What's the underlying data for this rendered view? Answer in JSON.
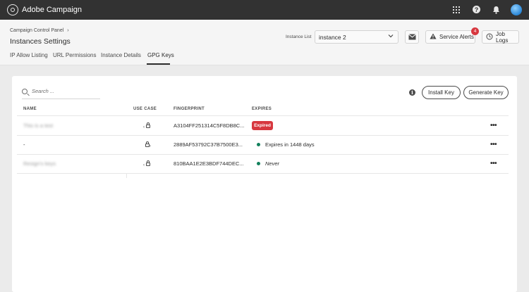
{
  "app": {
    "title": "Adobe Campaign"
  },
  "topbar": {
    "icons": [
      "apps-grid-icon",
      "help-icon",
      "notifications-bell-icon",
      "user-avatar"
    ]
  },
  "header": {
    "breadcrumb": "Campaign Control Panel",
    "breadcrumb_chevron": "›",
    "title": "Instances Settings",
    "tabs": [
      {
        "label": "IP Allow Listing",
        "active": false
      },
      {
        "label": "URL Permissions",
        "active": false
      },
      {
        "label": "Instance Details",
        "active": false
      },
      {
        "label": "GPG Keys",
        "active": true
      }
    ],
    "instance_list_label": "Instance List",
    "instance_value": "instance 2",
    "service_alerts_label": "Service Alerts",
    "service_alerts_count": "4",
    "job_logs_label": "Job Logs"
  },
  "toolbar": {
    "search_placeholder": "Search ...",
    "install_key_label": "Install Key",
    "generate_key_label": "Generate Key"
  },
  "table": {
    "columns": [
      "NAME",
      "USE CASE",
      "FINGERPRINT",
      "EXPIRES"
    ],
    "rows": [
      {
        "name": "This is a test",
        "name_blurred": true,
        "use_case_icon": "lock-decrypt-icon",
        "fingerprint": "A3104FF251314C5F8DB8C...",
        "expires": "Expired",
        "expires_type": "expired"
      },
      {
        "name": "-",
        "name_blurred": false,
        "use_case_icon": "lock-encrypt-icon",
        "fingerprint": "2889AF53792C37B7500E3...",
        "expires": "Expires in 1448 days",
        "expires_type": "active"
      },
      {
        "name": "Resign's keys",
        "name_blurred": true,
        "use_case_icon": "lock-decrypt-icon",
        "fingerprint": "810BAA1E2E3BDF744DEC...",
        "expires": "Never",
        "expires_type": "never"
      }
    ],
    "row_action": "•••"
  },
  "colors": {
    "topbar": "#323232",
    "expired": "#d7373f",
    "active_dot": "#12805c",
    "badge": "#d7373f"
  }
}
